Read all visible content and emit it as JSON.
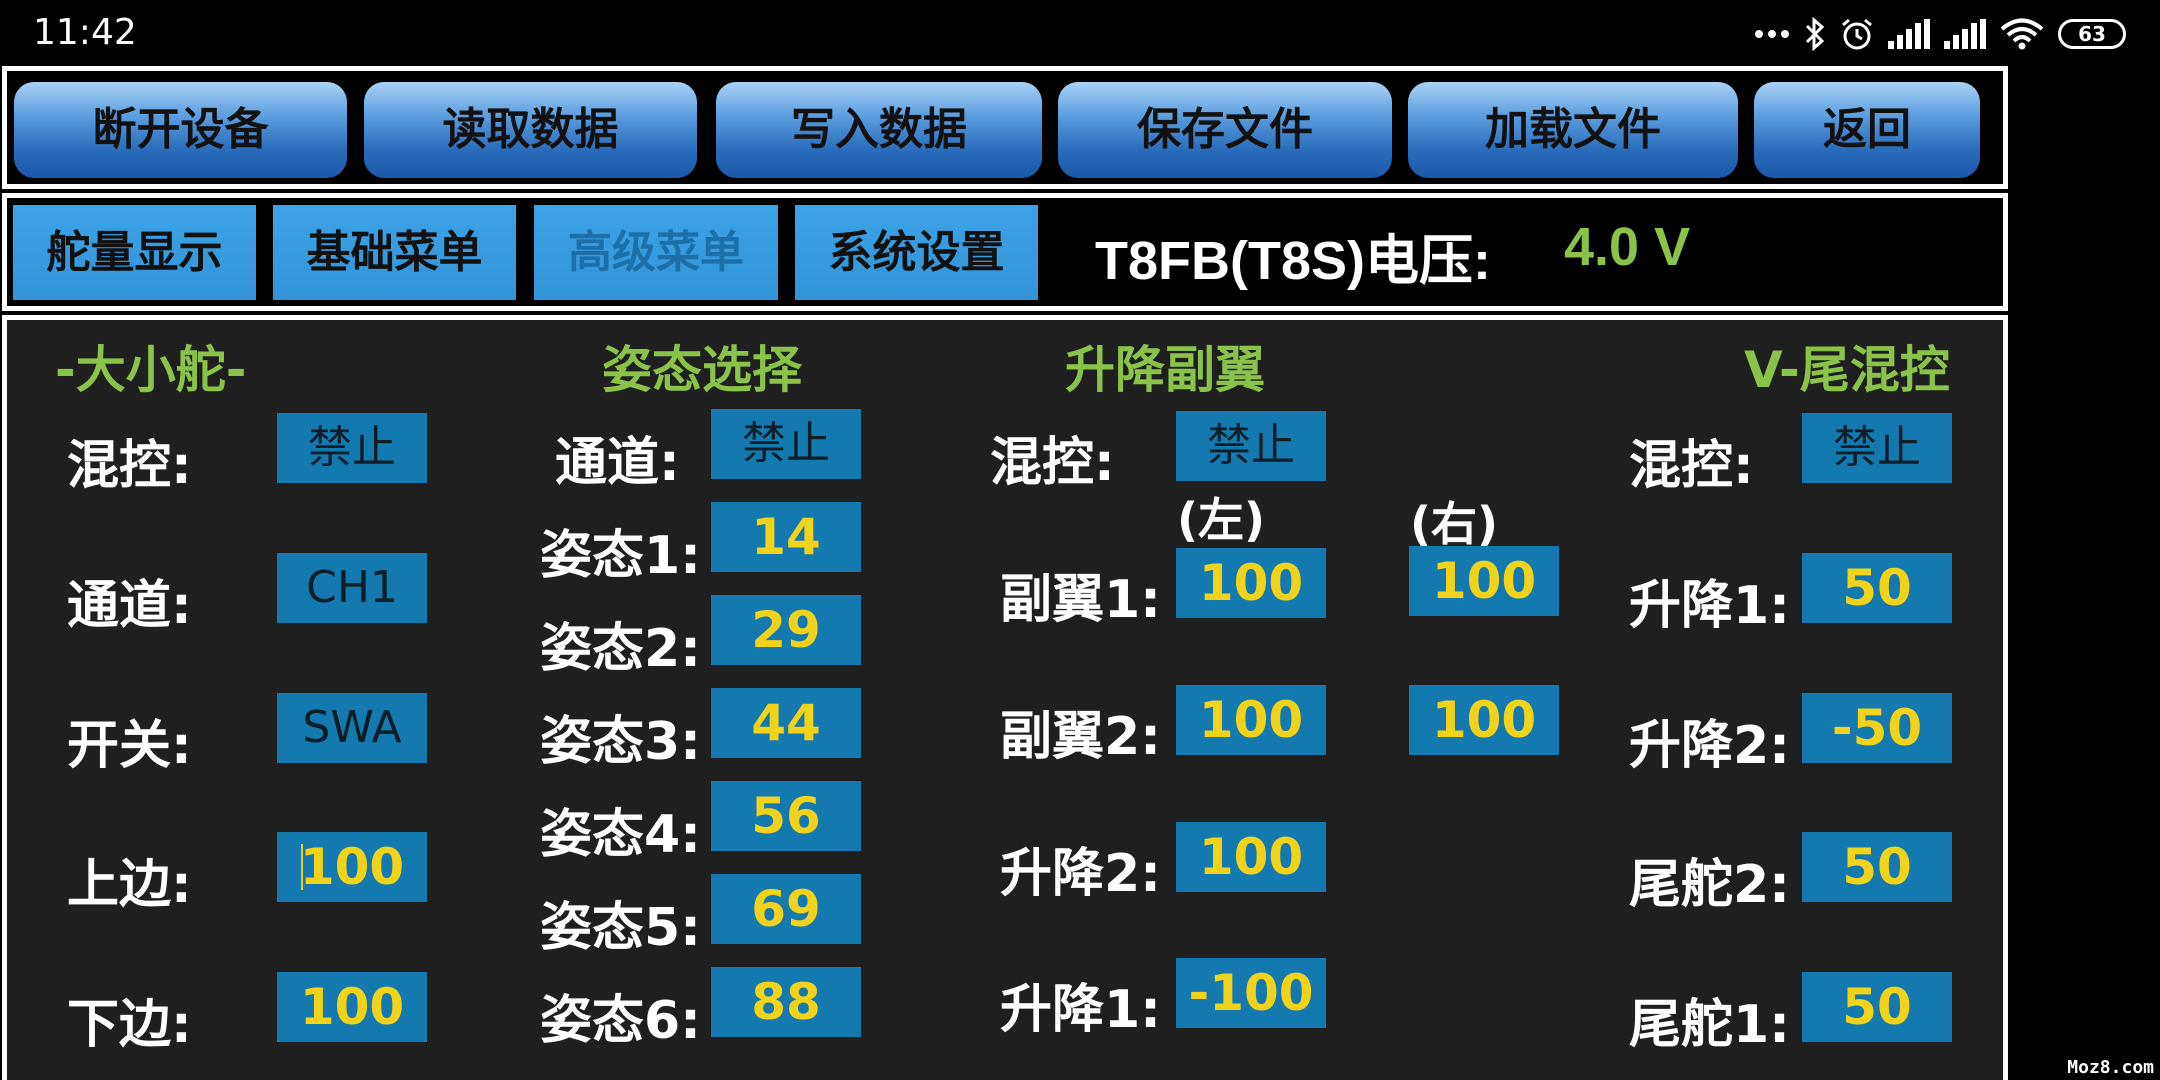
{
  "status_bar": {
    "time": "11:42",
    "battery": "63",
    "icons": [
      "more-icon",
      "bluetooth-icon",
      "alarm-icon",
      "signal-icon",
      "signal-icon",
      "wifi-icon",
      "battery-icon"
    ]
  },
  "toolbar": {
    "disconnect": "断开设备",
    "read": "读取数据",
    "write": "写入数据",
    "save": "保存文件",
    "load": "加载文件",
    "back": "返回"
  },
  "menu": {
    "tabs": [
      "舵量显示",
      "基础菜单",
      "高级菜单",
      "系统设置"
    ],
    "active_tab": "高级菜单",
    "voltage_label": "T8FB(T8S)电压:",
    "voltage_value": "4.0 V"
  },
  "dual_rate": {
    "title": "-大小舵-",
    "mix_label": "混控:",
    "mix_value": "禁止",
    "channel_label": "通道:",
    "channel_value": "CH1",
    "switch_label": "开关:",
    "switch_value": "SWA",
    "upper_label": "上边:",
    "upper_value": "100",
    "lower_label": "下边:",
    "lower_value": "100"
  },
  "flight_mode": {
    "title": "姿态选择",
    "channel_label": "通道:",
    "channel_value": "禁止",
    "modes": [
      {
        "label": "姿态1:",
        "value": "14"
      },
      {
        "label": "姿态2:",
        "value": "29"
      },
      {
        "label": "姿态3:",
        "value": "44"
      },
      {
        "label": "姿态4:",
        "value": "56"
      },
      {
        "label": "姿态5:",
        "value": "69"
      },
      {
        "label": "姿态6:",
        "value": "88"
      }
    ]
  },
  "flaperon": {
    "title": "升降副翼",
    "mix_label": "混控:",
    "mix_value": "禁止",
    "left_label": "(左)",
    "right_label": "(右)",
    "aileron1_label": "副翼1:",
    "aileron1_left": "100",
    "aileron1_right": "100",
    "aileron2_label": "副翼2:",
    "aileron2_left": "100",
    "aileron2_right": "100",
    "elevator2_label": "升降2:",
    "elevator2_value": "100",
    "elevator1_label": "升降1:",
    "elevator1_value": "-100"
  },
  "vtail": {
    "title": "V-尾混控",
    "mix_label": "混控:",
    "mix_value": "禁止",
    "elevator1_label": "升降1:",
    "elevator1_value": "50",
    "elevator2_label": "升降2:",
    "elevator2_value": "-50",
    "rudder2_label": "尾舵2:",
    "rudder2_value": "50",
    "rudder1_label": "尾舵1:",
    "rudder1_value": "50"
  },
  "watermark": "Moz8.com",
  "colors": {
    "accent_green": "#8bc34a",
    "value_yellow": "#f2d31b",
    "value_box": "#1479ae",
    "button_blue": "#2a6dbb"
  }
}
